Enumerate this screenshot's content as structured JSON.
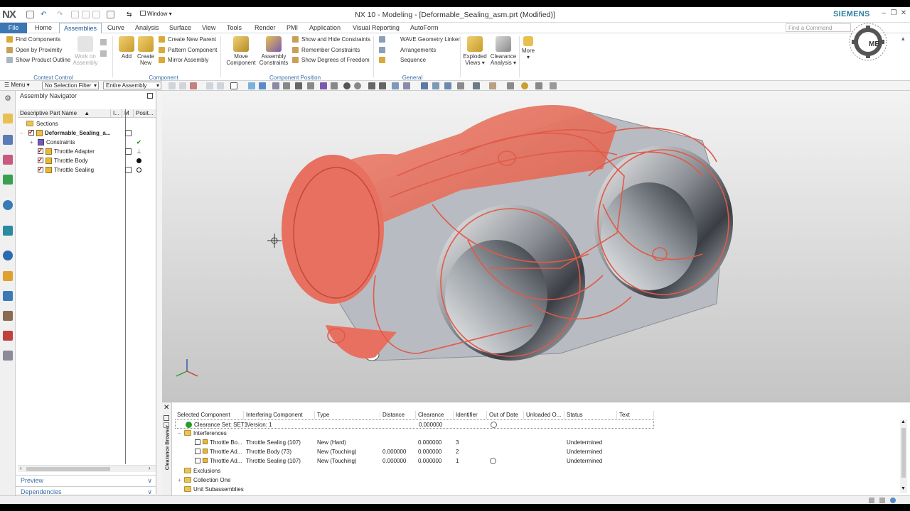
{
  "app": {
    "logo": "NX",
    "title": "NX 10 - Modeling - [Deformable_Sealing_asm.prt (Modified)]",
    "brand": "SIEMENS",
    "window_menu": "Window",
    "find_command_placeholder": "Find a Command",
    "watermark": "ME"
  },
  "menu": {
    "tabs": [
      "File",
      "Home",
      "Assemblies",
      "Curve",
      "Analysis",
      "Surface",
      "View",
      "Tools",
      "Render",
      "PMI",
      "Application",
      "Visual Reporting",
      "AutoForm"
    ],
    "active": "Assemblies"
  },
  "ribbon": {
    "context_control": {
      "label": "Context Control",
      "items": [
        "Find Components",
        "Open by Proximity",
        "Show Product Outline"
      ],
      "work_on": "Work on Assembly"
    },
    "component": {
      "label": "Component",
      "add": "Add",
      "create_new": "Create New",
      "items": [
        "Create New Parent",
        "Pattern Component",
        "Mirror Assembly"
      ]
    },
    "component_position": {
      "label": "Component Position",
      "move": "Move Component",
      "constraints": "Assembly Constraints",
      "items": [
        "Show and Hide Constraints",
        "Remember Constraints",
        "Show Degrees of Freedom"
      ]
    },
    "general": {
      "label": "General",
      "items": [
        "WAVE Geometry Linker",
        "Arrangements",
        "Sequence"
      ]
    },
    "exploded": "Exploded Views",
    "clearance": "Clearance Analysis",
    "more": "More"
  },
  "toolbar": {
    "menu": "Menu",
    "selection_filter": "No Selection Filter",
    "scope": "Entire Assembly"
  },
  "navigator": {
    "title": "Assembly Navigator",
    "columns": [
      "Descriptive Part Name",
      "I...",
      "M",
      "Posit..."
    ],
    "rows": [
      {
        "name": "Sections",
        "indent": 0
      },
      {
        "name": "Deformable_Sealing_a...",
        "indent": 0
      },
      {
        "name": "Constraints",
        "indent": 1
      },
      {
        "name": "Throttle Adapter",
        "indent": 1
      },
      {
        "name": "Throttle Body",
        "indent": 1
      },
      {
        "name": "Throttle Sealing",
        "indent": 1
      }
    ],
    "preview": "Preview",
    "dependencies": "Dependencies"
  },
  "clearance_browser": {
    "side_label": "Clearance Browser",
    "columns": [
      "Selected Component",
      "Interfering Component",
      "Type",
      "Distance",
      "Clearance",
      "Identifier",
      "Out of Date",
      "Unloaded O...",
      "Status",
      "Text"
    ],
    "set_row": {
      "selected": "Clearance Set: SET1",
      "interfering": "Version: 1",
      "clearance": "0.000000"
    },
    "interferences_label": "Interferences",
    "rows": [
      {
        "selected": "Throttle Bo...",
        "interfering": "Throttle Sealing (107)",
        "type": "New (Hard)",
        "distance": "",
        "clearance": "0.000000",
        "identifier": "3",
        "status": "Undetermined"
      },
      {
        "selected": "Throttle Ad...",
        "interfering": "Throttle Body (73)",
        "type": "New (Touching)",
        "distance": "0.000000",
        "clearance": "0.000000",
        "identifier": "2",
        "status": "Undetermined"
      },
      {
        "selected": "Throttle Ad...",
        "interfering": "Throttle Sealing (107)",
        "type": "New (Touching)",
        "distance": "0.000000",
        "clearance": "0.000000",
        "identifier": "1",
        "status": "Undetermined"
      }
    ],
    "groups": [
      "Exclusions",
      "Collection One",
      "Unit Subassemblies"
    ]
  },
  "colors": {
    "accent": "#3a77b4",
    "seal": "#e8705e",
    "metal": "#9aa0a6"
  }
}
